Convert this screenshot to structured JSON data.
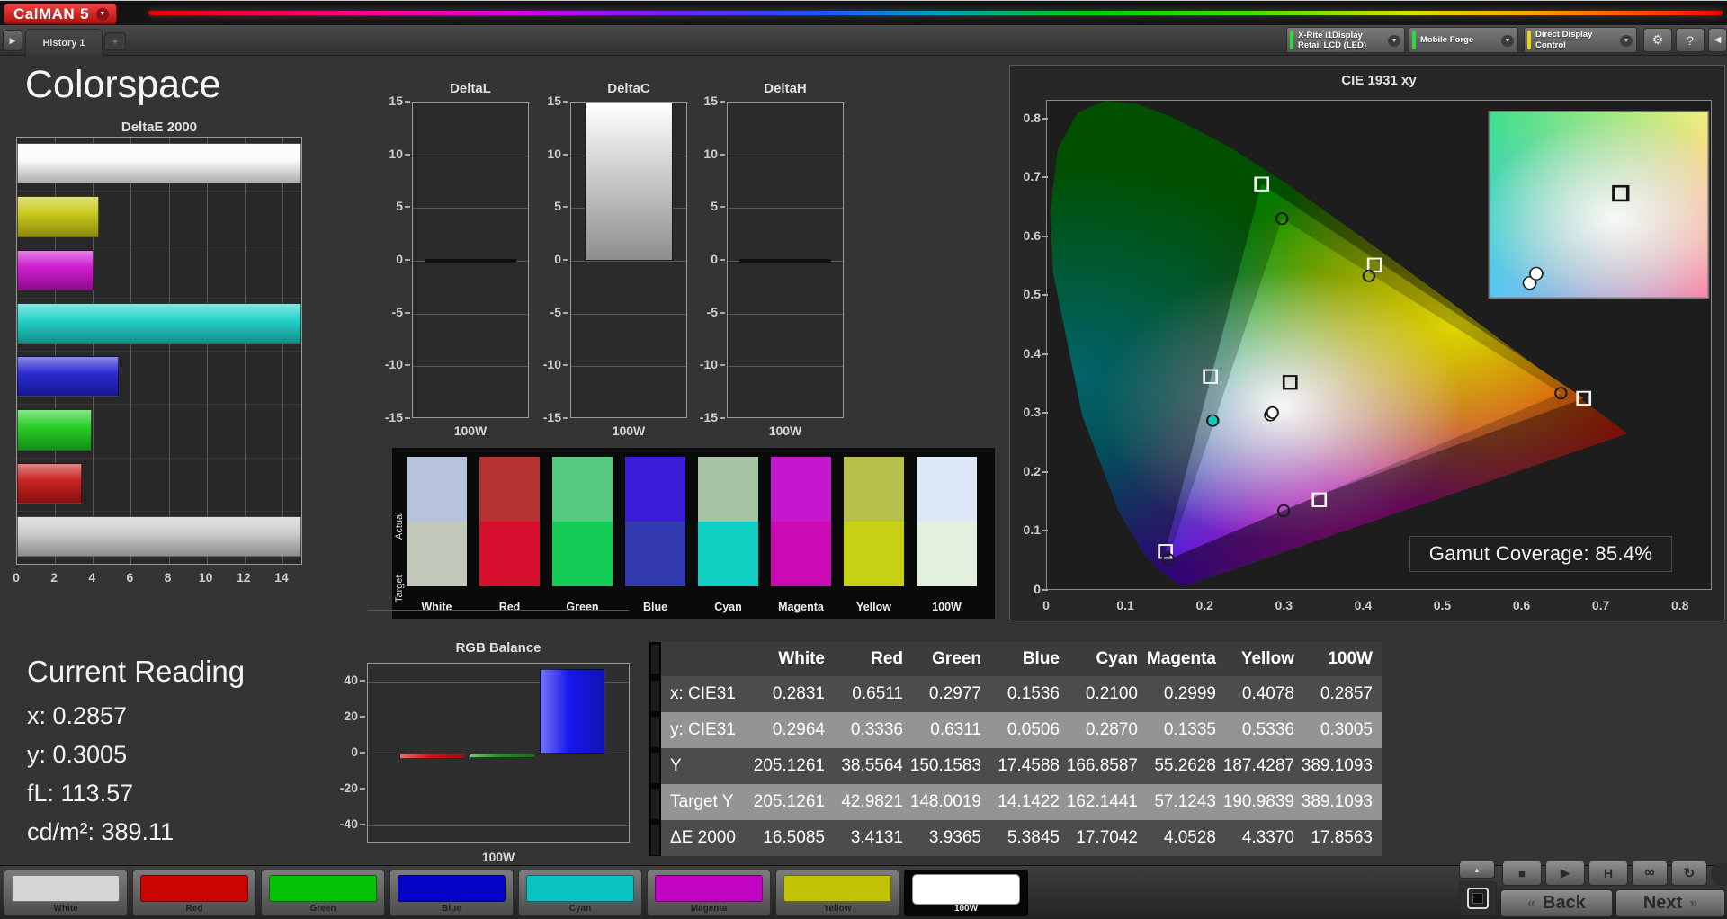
{
  "app": {
    "logo_text": "CalMAN",
    "logo_version": "5",
    "tab": "History 1",
    "dropdowns": [
      {
        "label": "X-Rite i1Display Retail LCD (LED)",
        "status_color": "#35d93c"
      },
      {
        "label": "Mobile Forge",
        "status_color": "#35d93c"
      },
      {
        "label": "Direct Display Control",
        "status_color": "#e8d41c"
      }
    ]
  },
  "icons": {
    "gear": "⚙",
    "help": "?",
    "collapse": "◀",
    "caret": "▼",
    "tab_play": "▶",
    "tab_add": "+",
    "up": "▲",
    "back_chev": "«",
    "next_chev": "»",
    "stop": "■",
    "play": "▶",
    "hold": "H",
    "loop": "∞",
    "refresh": "↻"
  },
  "page_title": "Colorspace",
  "current_reading": {
    "title": "Current Reading",
    "lines": [
      "x: 0.2857",
      "y: 0.3005",
      "fL: 113.57",
      "cd/m²: 389.11"
    ]
  },
  "buttons": {
    "back": "Back",
    "next": "Next"
  },
  "swatch_panel": {
    "row_labels": [
      "Actual",
      "Target"
    ],
    "columns": [
      {
        "label": "White",
        "actual": "#b6c2de",
        "target": "#c2c9ba"
      },
      {
        "label": "Red",
        "actual": "#b23330",
        "target": "#d60f2e"
      },
      {
        "label": "Green",
        "actual": "#55c97e",
        "target": "#13cb55"
      },
      {
        "label": "Blue",
        "actual": "#3b1cd8",
        "target": "#3339ae"
      },
      {
        "label": "Cyan",
        "actual": "#a6c4a3",
        "target": "#0fd0c2"
      },
      {
        "label": "Magenta",
        "actual": "#c517ce",
        "target": "#cb0ab6"
      },
      {
        "label": "Yellow",
        "actual": "#b8c04b",
        "target": "#c8d014"
      },
      {
        "label": "100W",
        "actual": "#dce7f8",
        "target": "#e3f0dd"
      }
    ]
  },
  "bottom_patches": [
    {
      "label": "White",
      "color": "#d6d6d6",
      "selected": false
    },
    {
      "label": "Red",
      "color": "#cb0404",
      "selected": false
    },
    {
      "label": "Green",
      "color": "#04c204",
      "selected": false
    },
    {
      "label": "Blue",
      "color": "#0404c6",
      "selected": false
    },
    {
      "label": "Cyan",
      "color": "#09c2c2",
      "selected": false
    },
    {
      "label": "Magenta",
      "color": "#c204c2",
      "selected": false
    },
    {
      "label": "Yellow",
      "color": "#c2c204",
      "selected": false
    },
    {
      "label": "100W",
      "color": "#ffffff",
      "selected": true
    }
  ],
  "chart_data": [
    {
      "id": "deltaE2000",
      "type": "bar",
      "orientation": "horizontal",
      "title": "DeltaE 2000",
      "xlim": [
        0,
        15
      ],
      "xticks": [
        0,
        2,
        4,
        6,
        8,
        10,
        12,
        14
      ],
      "grid": true,
      "categories": [
        "White",
        "Yellow",
        "Magenta",
        "Cyan",
        "Blue",
        "Green",
        "Red",
        "100W"
      ],
      "values": [
        16.5085,
        4.337,
        4.0528,
        17.7042,
        5.3845,
        3.9365,
        3.4131,
        17.8563
      ],
      "bar_colors": [
        "#fafafa",
        "#c6c60e",
        "#cc10cc",
        "#17cfc4",
        "#1f1fd0",
        "#1dcb1d",
        "#c61616",
        "#c9c9c9"
      ]
    },
    {
      "id": "deltaL",
      "type": "bar",
      "title": "DeltaL",
      "categories": [
        "100W"
      ],
      "values": [
        0
      ],
      "ylim": [
        -15,
        15
      ],
      "yticks": [
        15,
        10,
        5,
        0,
        -5,
        -10,
        -15
      ],
      "xlabel": "100W"
    },
    {
      "id": "deltaC",
      "type": "bar",
      "title": "DeltaC",
      "categories": [
        "100W"
      ],
      "values": [
        16
      ],
      "note": "bar clipped at +15",
      "ylim": [
        -15,
        15
      ],
      "yticks": [
        15,
        10,
        5,
        0,
        -5,
        -10,
        -15
      ],
      "xlabel": "100W"
    },
    {
      "id": "deltaH",
      "type": "bar",
      "title": "DeltaH",
      "categories": [
        "100W"
      ],
      "values": [
        0
      ],
      "ylim": [
        -15,
        15
      ],
      "yticks": [
        15,
        10,
        5,
        0,
        -5,
        -10,
        -15
      ],
      "xlabel": "100W"
    },
    {
      "id": "rgbBalance",
      "type": "bar",
      "title": "RGB Balance",
      "xlabel": "100W",
      "categories": [
        "Red",
        "Green",
        "Blue"
      ],
      "values": [
        -3,
        -2.5,
        47
      ],
      "ylim": [
        -50,
        50
      ],
      "yticks": [
        40,
        20,
        0,
        -20,
        -40
      ],
      "bar_colors": [
        "#d81212",
        "#169a16",
        "#1717ee"
      ]
    },
    {
      "id": "cie",
      "type": "scatter",
      "title": "CIE 1931 xy",
      "xlim": [
        0,
        0.84
      ],
      "ylim": [
        0,
        0.832
      ],
      "xticks": [
        "0",
        "0.1",
        "0.2",
        "0.3",
        "0.4",
        "0.5",
        "0.6",
        "0.7",
        "0.8"
      ],
      "yticks": [
        "0.8",
        "0.7",
        "0.6",
        "0.5",
        "0.4",
        "0.3",
        "0.2",
        "0.1",
        "0"
      ],
      "annotation": "Gamut Coverage:  85.4%",
      "gamut_measured": [
        [
          0.6511,
          0.3336
        ],
        [
          0.2977,
          0.6311
        ],
        [
          0.1536,
          0.0506
        ]
      ],
      "gamut_target": [
        [
          0.68,
          0.325
        ],
        [
          0.272,
          0.69
        ],
        [
          0.15,
          0.064
        ]
      ],
      "targets": [
        {
          "name": "white",
          "x": 0.308,
          "y": 0.352,
          "stroke": "#141414"
        },
        {
          "name": "red",
          "x": 0.68,
          "y": 0.325,
          "stroke": "#f5f5f5"
        },
        {
          "name": "green",
          "x": 0.272,
          "y": 0.69,
          "stroke": "#f5f5f5"
        },
        {
          "name": "blue",
          "x": 0.15,
          "y": 0.064,
          "stroke": "#f5f5f5"
        },
        {
          "name": "cyan",
          "x": 0.207,
          "y": 0.362,
          "stroke": "#f5f5f5"
        },
        {
          "name": "magenta",
          "x": 0.345,
          "y": 0.152,
          "stroke": "#f5f5f5"
        },
        {
          "name": "yellow",
          "x": 0.415,
          "y": 0.552,
          "stroke": "#f5f5f5"
        }
      ],
      "measured": [
        {
          "name": "white",
          "x": 0.2831,
          "y": 0.2964,
          "fill": "#ffffff"
        },
        {
          "name": "100w",
          "x": 0.2857,
          "y": 0.3005,
          "fill": "#ffffff"
        },
        {
          "name": "red",
          "x": 0.6511,
          "y": 0.3336,
          "fill": "none"
        },
        {
          "name": "green",
          "x": 0.2977,
          "y": 0.6311,
          "fill": "none"
        },
        {
          "name": "blue",
          "x": 0.1536,
          "y": 0.0506,
          "fill": "none"
        },
        {
          "name": "cyan",
          "x": 0.21,
          "y": 0.287,
          "fill": "#14c9ba"
        },
        {
          "name": "magenta",
          "x": 0.2999,
          "y": 0.1335,
          "fill": "none"
        },
        {
          "name": "yellow",
          "x": 0.4078,
          "y": 0.5336,
          "fill": "none"
        }
      ],
      "inset": {
        "square": {
          "fx": 0.6,
          "fy": 0.44
        },
        "circles": [
          {
            "fx": 0.185,
            "fy": 0.92
          },
          {
            "fx": 0.215,
            "fy": 0.87
          }
        ]
      }
    },
    {
      "id": "results",
      "type": "table",
      "columns": [
        "",
        "White",
        "Red",
        "Green",
        "Blue",
        "Cyan",
        "Magenta",
        "Yellow",
        "100W"
      ],
      "rows": [
        {
          "label": "x: CIE31",
          "shade": "dark",
          "values": [
            "0.2831",
            "0.6511",
            "0.2977",
            "0.1536",
            "0.2100",
            "0.2999",
            "0.4078",
            "0.2857"
          ]
        },
        {
          "label": "y: CIE31",
          "shade": "light",
          "values": [
            "0.2964",
            "0.3336",
            "0.6311",
            "0.0506",
            "0.2870",
            "0.1335",
            "0.5336",
            "0.3005"
          ]
        },
        {
          "label": "Y",
          "shade": "dark",
          "values": [
            "205.1261",
            "38.5564",
            "150.1583",
            "17.4588",
            "166.8587",
            "55.2628",
            "187.4287",
            "389.1093"
          ]
        },
        {
          "label": "Target Y",
          "shade": "light",
          "values": [
            "205.1261",
            "42.9821",
            "148.0019",
            "14.1422",
            "162.1441",
            "57.1243",
            "190.9839",
            "389.1093"
          ]
        },
        {
          "label": "ΔE 2000",
          "shade": "dark",
          "values": [
            "16.5085",
            "3.4131",
            "3.9365",
            "5.3845",
            "17.7042",
            "4.0528",
            "4.3370",
            "17.8563"
          ]
        }
      ]
    }
  ]
}
